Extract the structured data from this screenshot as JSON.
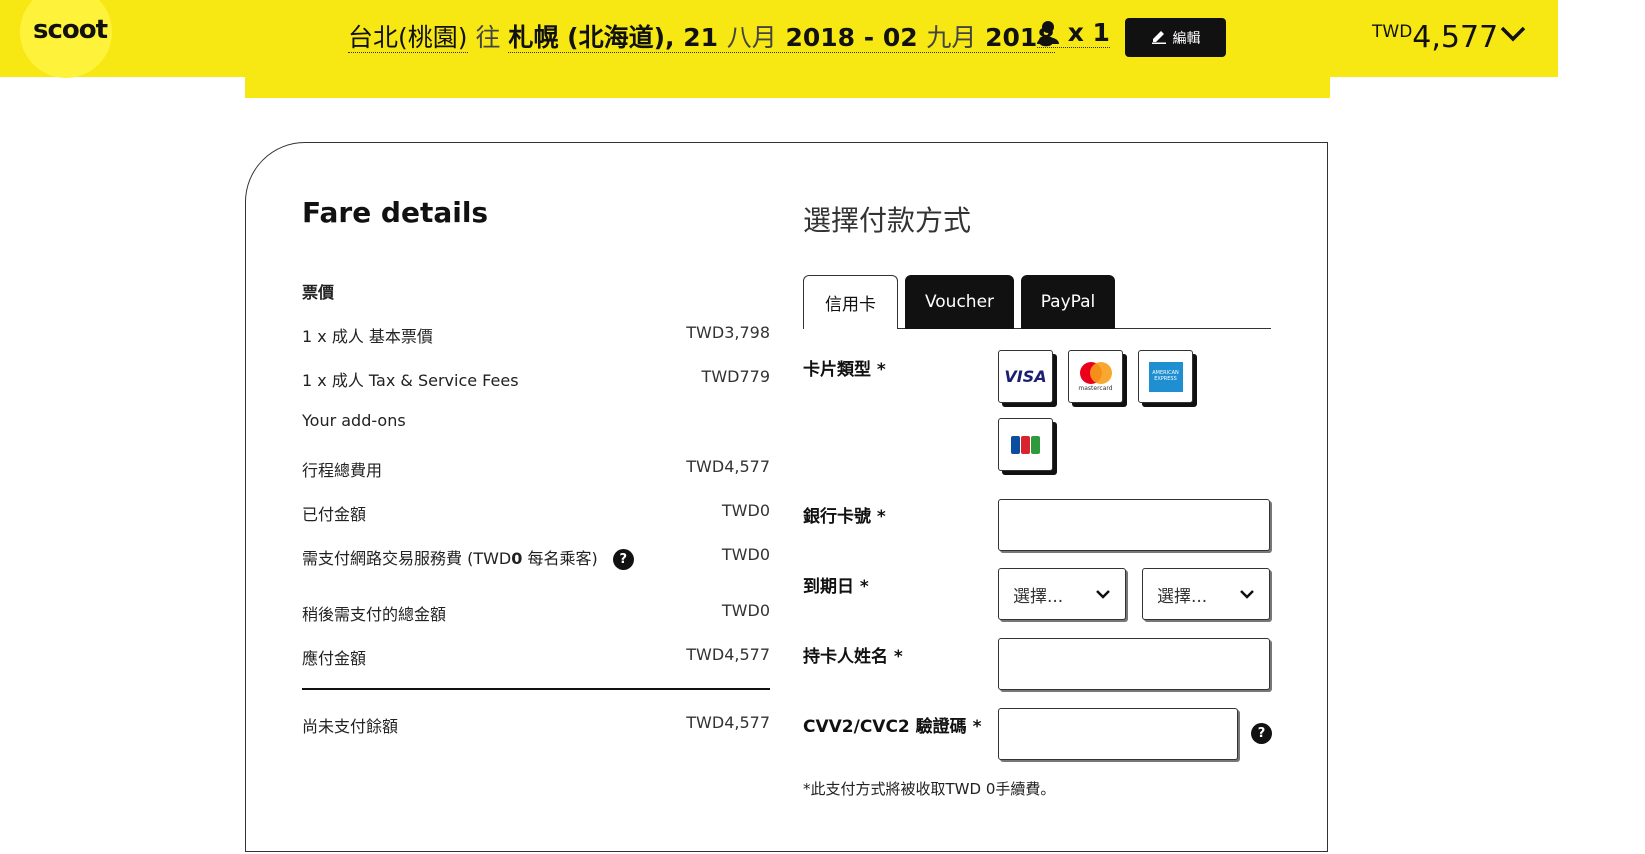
{
  "header": {
    "logo": "scoot",
    "origin": "台北(桃園)",
    "to_word": "往",
    "destination": "札幌 (北海道)",
    "comma": ",",
    "dep_day": "21",
    "dep_month": "八月",
    "dep_year": "2018",
    "dash": "-",
    "ret_day": "02",
    "ret_month": "九月",
    "ret_year": "2018",
    "pax_label": "x 1",
    "edit_label": "編輯",
    "total_currency": "TWD",
    "total_amount": "4,577",
    "colors": {
      "brand_yellow": "#f7e814",
      "dark": "#111111"
    }
  },
  "fare": {
    "title": "Fare details",
    "section_label": "票價",
    "rows": [
      {
        "label": "1 x 成人 基本票價",
        "value": "TWD3,798"
      },
      {
        "label": "1 x 成人 Tax & Service Fees",
        "value": "TWD779"
      }
    ],
    "addons_label": "Your add-ons",
    "trip_total_label": "行程總費用",
    "trip_total_value": "TWD4,577",
    "paid_label": "已付金額",
    "paid_value": "TWD0",
    "fee_label_prefix": "需支付網路交易服務費 (TWD",
    "fee_label_bold": "0",
    "fee_label_suffix": " 每名乘客)",
    "fee_value": "TWD0",
    "later_label": "稍後需支付的總金額",
    "later_value": "TWD0",
    "due_label": "應付金額",
    "due_value": "TWD4,577",
    "balance_label": "尚未支付餘額",
    "balance_value": "TWD4,577"
  },
  "payment": {
    "title": "選擇付款方式",
    "tabs": [
      {
        "label": "信用卡",
        "active": true
      },
      {
        "label": "Voucher",
        "active": false
      },
      {
        "label": "PayPal",
        "active": false
      }
    ],
    "card_type_label": "卡片類型 *",
    "card_types": [
      "VISA",
      "mastercard",
      "AMERICAN EXPRESS",
      "JCB"
    ],
    "card_number_label": "銀行卡號 *",
    "expiry_label": "到期日 *",
    "expiry_month_placeholder": "選擇...",
    "expiry_year_placeholder": "選擇...",
    "holder_label": "持卡人姓名 *",
    "cvv_label": "CVV2/CVC2 驗證碼 *",
    "note": "*此支付方式將被收取TWD 0手續費。"
  }
}
